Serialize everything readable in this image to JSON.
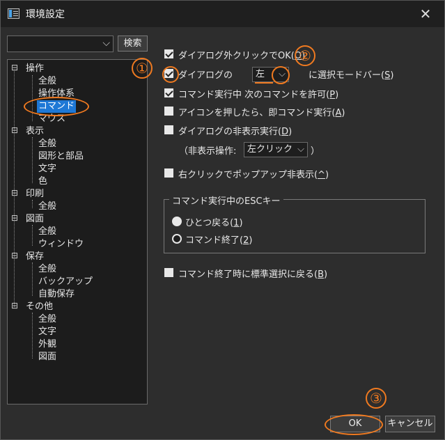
{
  "window": {
    "title": "環境設定",
    "close": "✕"
  },
  "search": {
    "value": "",
    "button": "検索"
  },
  "tree": {
    "nodes": [
      {
        "label": "操作",
        "toggle": "⊟"
      },
      {
        "label": "全般"
      },
      {
        "label": "操作体系"
      },
      {
        "label": "コマンド"
      },
      {
        "label": "マウス"
      },
      {
        "label": "表示",
        "toggle": "⊟"
      },
      {
        "label": "全般"
      },
      {
        "label": "図形と部品"
      },
      {
        "label": "文字"
      },
      {
        "label": "色"
      },
      {
        "label": "印刷",
        "toggle": "⊟"
      },
      {
        "label": "全般"
      },
      {
        "label": "図面",
        "toggle": "⊟"
      },
      {
        "label": "全般"
      },
      {
        "label": "ウィンドウ"
      },
      {
        "label": "保存",
        "toggle": "⊟"
      },
      {
        "label": "全般"
      },
      {
        "label": "バックアップ"
      },
      {
        "label": "自動保存"
      },
      {
        "label": "その他",
        "toggle": "⊟"
      },
      {
        "label": "全般"
      },
      {
        "label": "文字"
      },
      {
        "label": "外観"
      },
      {
        "label": "図面"
      }
    ]
  },
  "options": {
    "dialog_outside_click_ok": {
      "label": "ダイアログ外クリックでOK(",
      "key": "O",
      "suffix": ")",
      "checked": true
    },
    "dialog_position": {
      "label": "ダイアログの",
      "value": "左",
      "suffix_label": "に選択モードバー(",
      "key": "S",
      "suffix": ")",
      "checked": true
    },
    "allow_next_command": {
      "label": "コマンド実行中 次のコマンドを許可(",
      "key": "P",
      "suffix": ")",
      "checked": true
    },
    "icon_command": {
      "label": "アイコンを押したら、即コマンド実行(",
      "key": "A",
      "suffix": ")",
      "checked": false
    },
    "hide_dialog": {
      "label": "ダイアログの非表示実行(",
      "key": "D",
      "suffix": ")",
      "checked": false
    },
    "hide_action_label_pre": "（非表示操作:",
    "hide_action_value": "左クリック",
    "hide_action_label_post": "）",
    "right_click_popup_hide": {
      "label": "右クリックでポップアップ非表示(",
      "key": "^",
      "suffix": ")",
      "checked": false
    },
    "esc_group": {
      "title": "コマンド実行中のESCキー",
      "radio1": {
        "label": "ひとつ戻る(",
        "key": "1",
        "suffix": ")",
        "selected": true
      },
      "radio2": {
        "label": "コマンド終了(",
        "key": "2",
        "suffix": ")",
        "selected": false
      }
    },
    "return_standard_select": {
      "label": "コマンド終了時に標準選択に戻る(",
      "key": "B",
      "suffix": ")",
      "checked": false
    }
  },
  "buttons": {
    "ok": "OK",
    "cancel": "キャンセル"
  },
  "annotations": {
    "one": "①",
    "two": "②",
    "three": "③"
  },
  "colors": {
    "accent": "#f07a20",
    "selection": "#1e78d6"
  }
}
